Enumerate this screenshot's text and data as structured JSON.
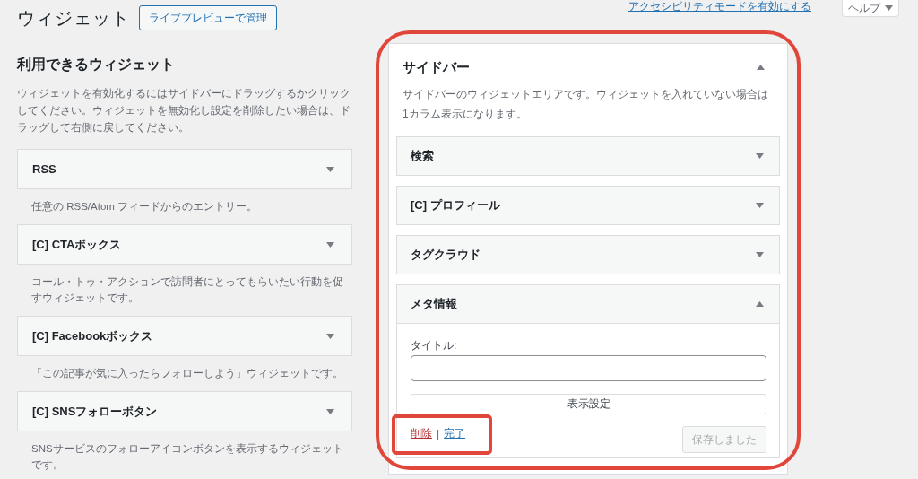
{
  "header": {
    "title": "ウィジェット",
    "live_preview_button": "ライブプレビューで管理",
    "accessibility_link": "アクセシビリティモードを有効にする",
    "help_tab": "ヘルプ"
  },
  "available_widgets": {
    "heading": "利用できるウィジェット",
    "description": "ウィジェットを有効化するにはサイドバーにドラッグするかクリックしてください。ウィジェットを無効化し設定を削除したい場合は、ドラッグして右側に戻してください。",
    "widgets": [
      {
        "title": "RSS",
        "description": "任意の RSS/Atom フィードからのエントリー。"
      },
      {
        "title": "[C] CTAボックス",
        "description": "コール・トゥ・アクションで訪問者にとってもらいたい行動を促すウィジェットです。"
      },
      {
        "title": "[C] Facebookボックス",
        "description": "「この記事が気に入ったらフォローしよう」ウィジェットです。"
      },
      {
        "title": "[C] SNSフォローボタン",
        "description": "SNSサービスのフォローアイコンボタンを表示するウィジェットです。"
      }
    ]
  },
  "sidebar": {
    "title": "サイドバー",
    "expanded": true,
    "highlighted": true,
    "description": "サイドバーのウィジェットエリアです。ウィジェットを入れていない場合は1カラム表示になります。",
    "widgets": [
      {
        "title": "検索",
        "expanded": false
      },
      {
        "title": "[C] プロフィール",
        "expanded": false
      },
      {
        "title": "タグクラウド",
        "expanded": false
      },
      {
        "title": "メタ情報",
        "expanded": true,
        "form": {
          "title_label": "タイトル:",
          "display_settings_button": "表示設定",
          "delete_link": "削除",
          "separator": "|",
          "done_link": "完了",
          "save_button": "保存しました",
          "save_disabled": true,
          "actions_highlighted": true
        }
      }
    ]
  }
}
